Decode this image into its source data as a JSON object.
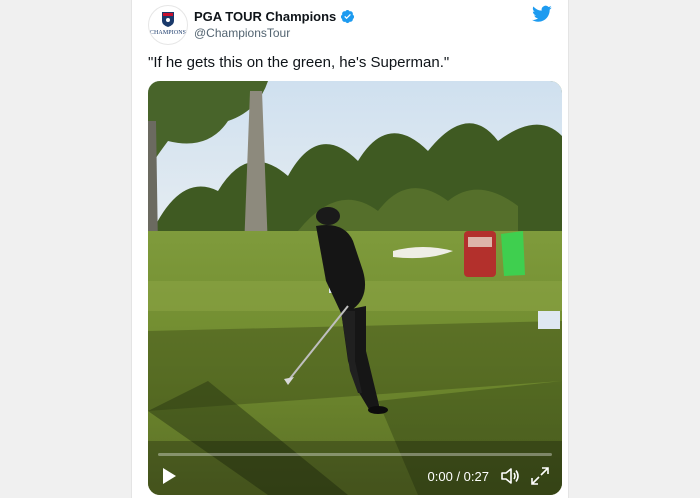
{
  "account": {
    "display_name": "PGA TOUR Champions",
    "handle": "@ChampionsTour",
    "avatar_brand_text": "CHAMPIONS",
    "verified": true
  },
  "tweet": {
    "text": "\"If he gets this on the green, he's Superman.\""
  },
  "video": {
    "current_time": "0:00",
    "duration": "0:27",
    "time_display": "0:00 / 0:27",
    "progress": 0,
    "state": "paused"
  },
  "icons": {
    "twitter_logo": "twitter-bird-icon",
    "verified_badge": "verified-badge-icon",
    "play": "play-icon",
    "volume": "volume-icon",
    "fullscreen": "fullscreen-icon"
  },
  "colors": {
    "twitter_blue": "#1d9bf0",
    "verified_blue": "#1d9bf0",
    "text_primary": "#0f1419",
    "text_secondary": "#536471"
  }
}
